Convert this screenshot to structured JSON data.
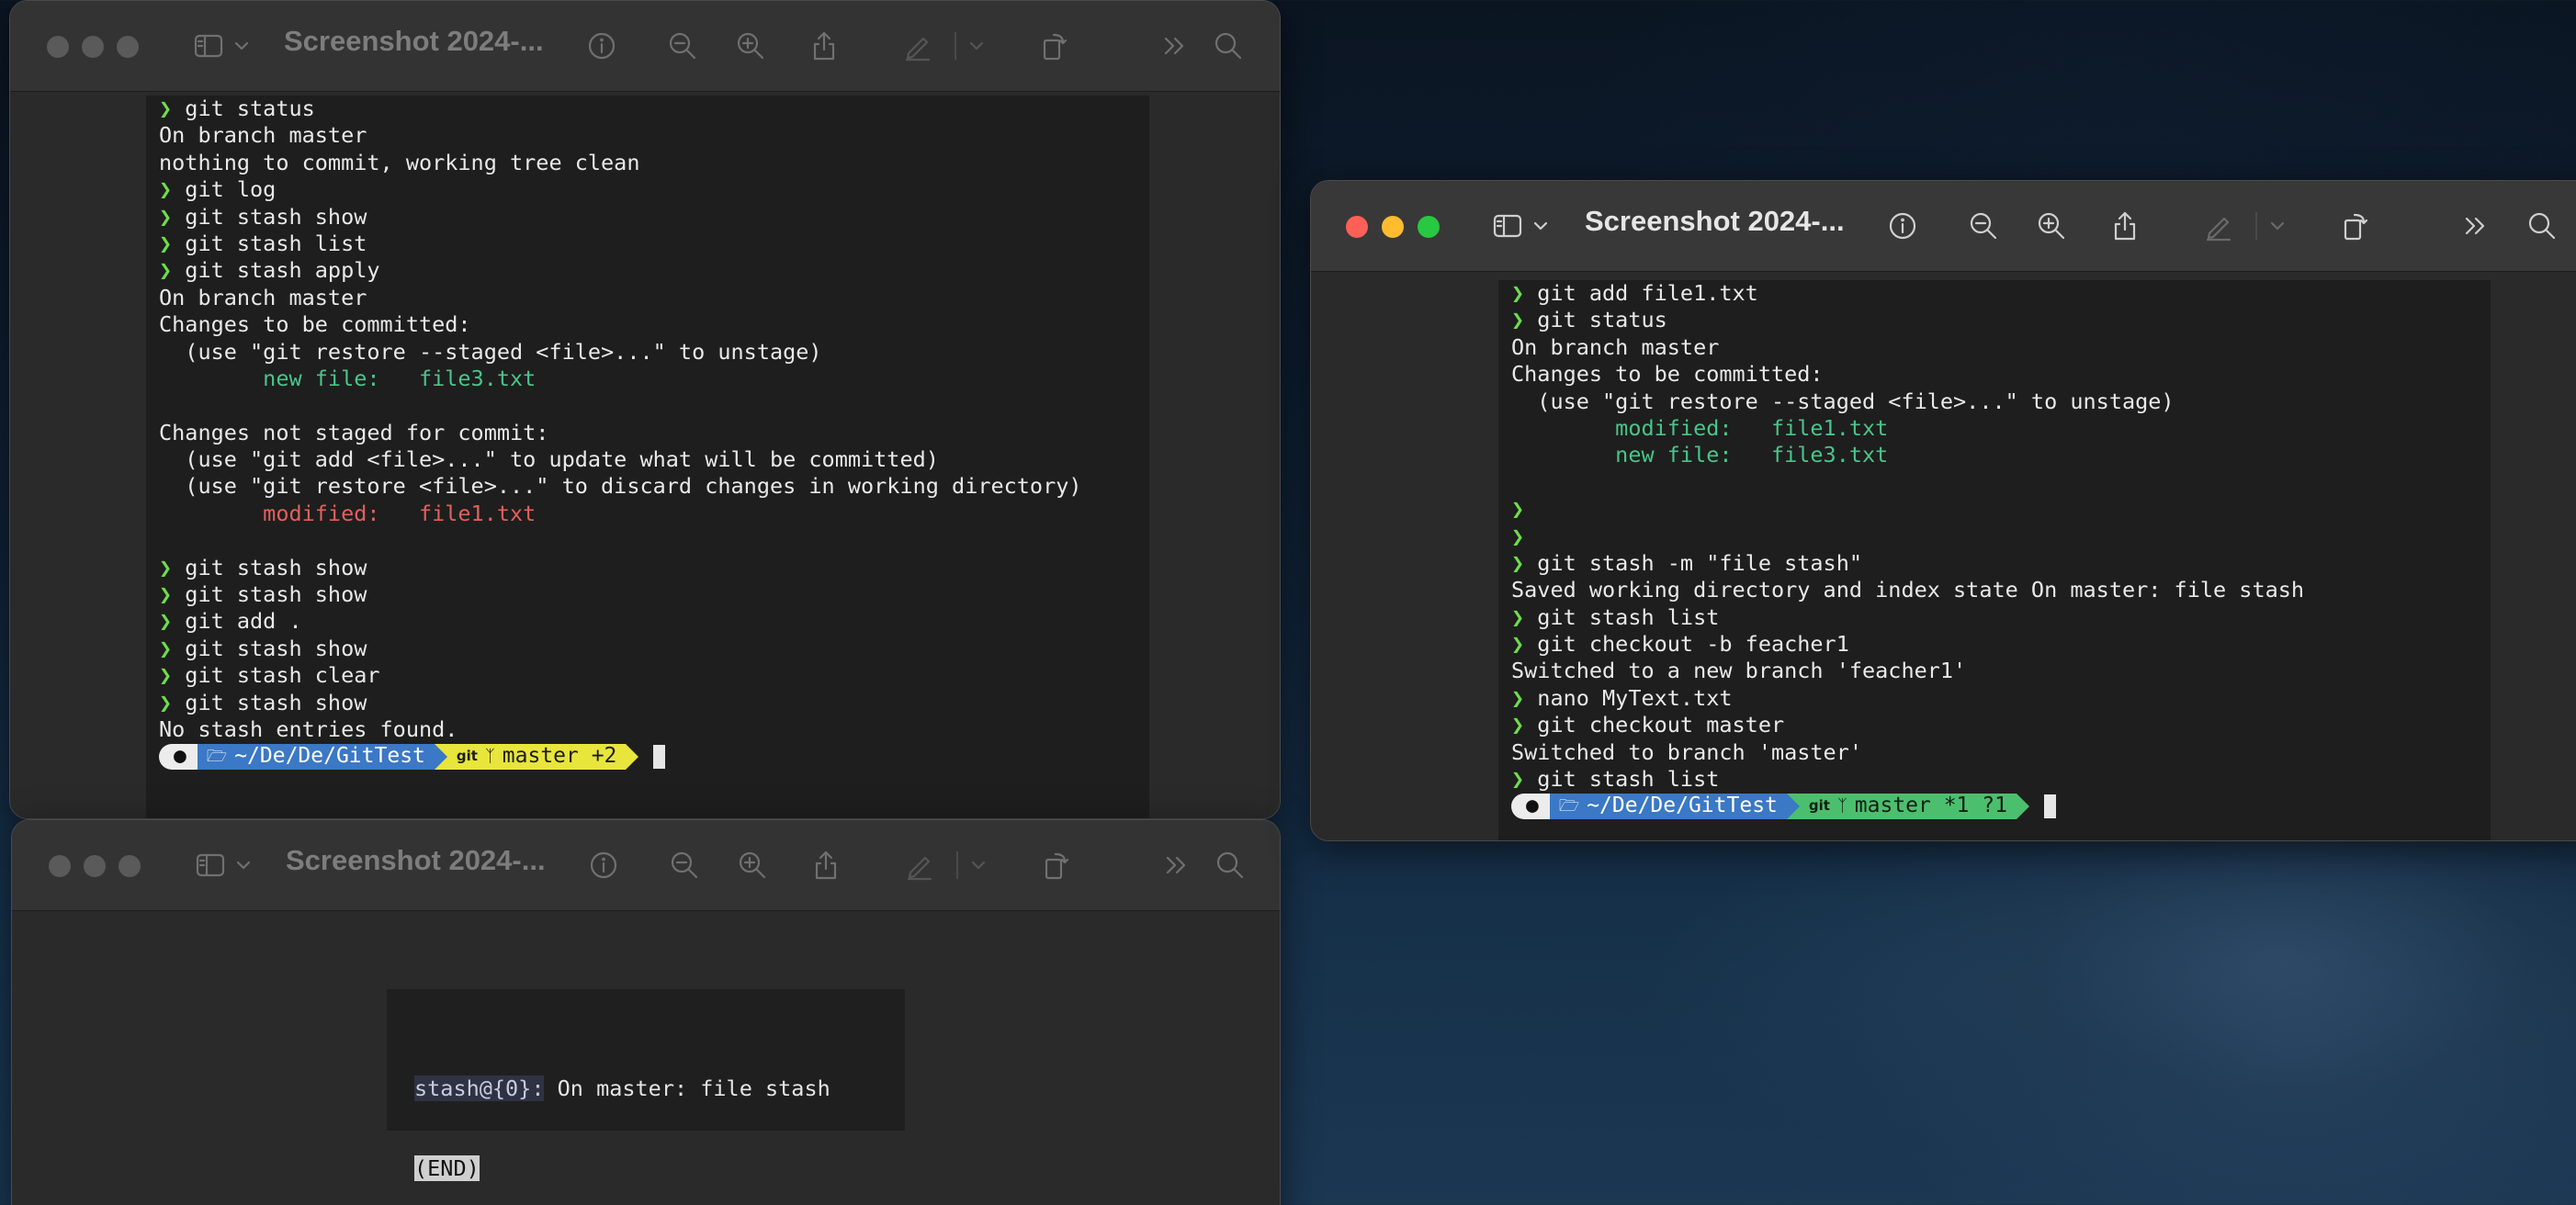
{
  "desktop": {
    "name": "macOS desktop wallpaper"
  },
  "windows": {
    "top_left": {
      "title": "Screenshot 2024-...",
      "state": "inactive",
      "lines": [
        {
          "prefix": "❯ ",
          "text": "git status",
          "color": "normal"
        },
        {
          "prefix": "",
          "text": "On branch master",
          "color": "normal"
        },
        {
          "prefix": "",
          "text": "nothing to commit, working tree clean",
          "color": "normal"
        },
        {
          "prefix": "❯ ",
          "text": "git log",
          "color": "normal"
        },
        {
          "prefix": "❯ ",
          "text": "git stash show",
          "color": "normal"
        },
        {
          "prefix": "❯ ",
          "text": "git stash list",
          "color": "normal"
        },
        {
          "prefix": "❯ ",
          "text": "git stash apply",
          "color": "normal"
        },
        {
          "prefix": "",
          "text": "On branch master",
          "color": "normal"
        },
        {
          "prefix": "",
          "text": "Changes to be committed:",
          "color": "normal"
        },
        {
          "prefix": "",
          "text": "  (use \"git restore --staged <file>...\" to unstage)",
          "color": "normal"
        },
        {
          "prefix": "",
          "text": "        new file:   file3.txt",
          "color": "green"
        },
        {
          "prefix": "",
          "text": "",
          "color": "normal"
        },
        {
          "prefix": "",
          "text": "Changes not staged for commit:",
          "color": "normal"
        },
        {
          "prefix": "",
          "text": "  (use \"git add <file>...\" to update what will be committed)",
          "color": "normal"
        },
        {
          "prefix": "",
          "text": "  (use \"git restore <file>...\" to discard changes in working directory)",
          "color": "normal"
        },
        {
          "prefix": "",
          "text": "        modified:   file1.txt",
          "color": "red"
        },
        {
          "prefix": "",
          "text": "",
          "color": "normal"
        },
        {
          "prefix": "❯ ",
          "text": "git stash show",
          "color": "normal"
        },
        {
          "prefix": "❯ ",
          "text": "git stash show",
          "color": "normal"
        },
        {
          "prefix": "❯ ",
          "text": "git add .",
          "color": "normal"
        },
        {
          "prefix": "❯ ",
          "text": "git stash show",
          "color": "normal"
        },
        {
          "prefix": "❯ ",
          "text": "git stash clear",
          "color": "normal"
        },
        {
          "prefix": "❯ ",
          "text": "git stash show",
          "color": "normal"
        },
        {
          "prefix": "",
          "text": "No stash entries found.",
          "color": "normal"
        }
      ],
      "prompt": {
        "path": "~/De/De/GitTest",
        "git_label": "git",
        "branch": "master +2",
        "branch_color": "#e8e53c"
      }
    },
    "bottom_left": {
      "title": "Screenshot 2024-...",
      "state": "inactive",
      "stash_ref": "stash@{0}:",
      "stash_msg": " On master: file stash",
      "end_marker": "(END)"
    },
    "right": {
      "title": "Screenshot 2024-...",
      "state": "active",
      "lines": [
        {
          "prefix": "❯ ",
          "text": "git add file1.txt",
          "color": "normal"
        },
        {
          "prefix": "❯ ",
          "text": "git status",
          "color": "normal"
        },
        {
          "prefix": "",
          "text": "On branch master",
          "color": "normal"
        },
        {
          "prefix": "",
          "text": "Changes to be committed:",
          "color": "normal"
        },
        {
          "prefix": "",
          "text": "  (use \"git restore --staged <file>...\" to unstage)",
          "color": "normal"
        },
        {
          "prefix": "",
          "text": "        modified:   file1.txt",
          "color": "green"
        },
        {
          "prefix": "",
          "text": "        new file:   file3.txt",
          "color": "green"
        },
        {
          "prefix": "",
          "text": "",
          "color": "normal"
        },
        {
          "prefix": "❯",
          "text": "",
          "color": "normal"
        },
        {
          "prefix": "❯",
          "text": "",
          "color": "normal"
        },
        {
          "prefix": "❯ ",
          "text": "git stash -m \"file stash\"",
          "color": "normal"
        },
        {
          "prefix": "",
          "text": "Saved working directory and index state On master: file stash",
          "color": "normal"
        },
        {
          "prefix": "❯ ",
          "text": "git stash list",
          "color": "normal"
        },
        {
          "prefix": "❯ ",
          "text": "git checkout -b feacher1",
          "color": "normal"
        },
        {
          "prefix": "",
          "text": "Switched to a new branch 'feacher1'",
          "color": "normal"
        },
        {
          "prefix": "❯ ",
          "text": "nano MyText.txt",
          "color": "normal"
        },
        {
          "prefix": "❯ ",
          "text": "git checkout master",
          "color": "normal"
        },
        {
          "prefix": "",
          "text": "Switched to branch 'master'",
          "color": "normal"
        },
        {
          "prefix": "❯ ",
          "text": "git stash list",
          "color": "normal"
        }
      ],
      "prompt": {
        "path": "~/De/De/GitTest",
        "git_label": "git",
        "branch": "master *1 ?1",
        "branch_color": "#4cbf6e"
      }
    }
  },
  "icons": {
    "sidebar": "sidebar-toggle-icon",
    "chevron": "chevron-down-icon",
    "info": "info-icon",
    "zoom_out": "zoom-out-icon",
    "zoom_in": "zoom-in-icon",
    "share": "share-icon",
    "markup": "pencil-markup-icon",
    "rotate": "rotate-icon",
    "more": "more-toolbar-icon",
    "search": "search-icon"
  }
}
